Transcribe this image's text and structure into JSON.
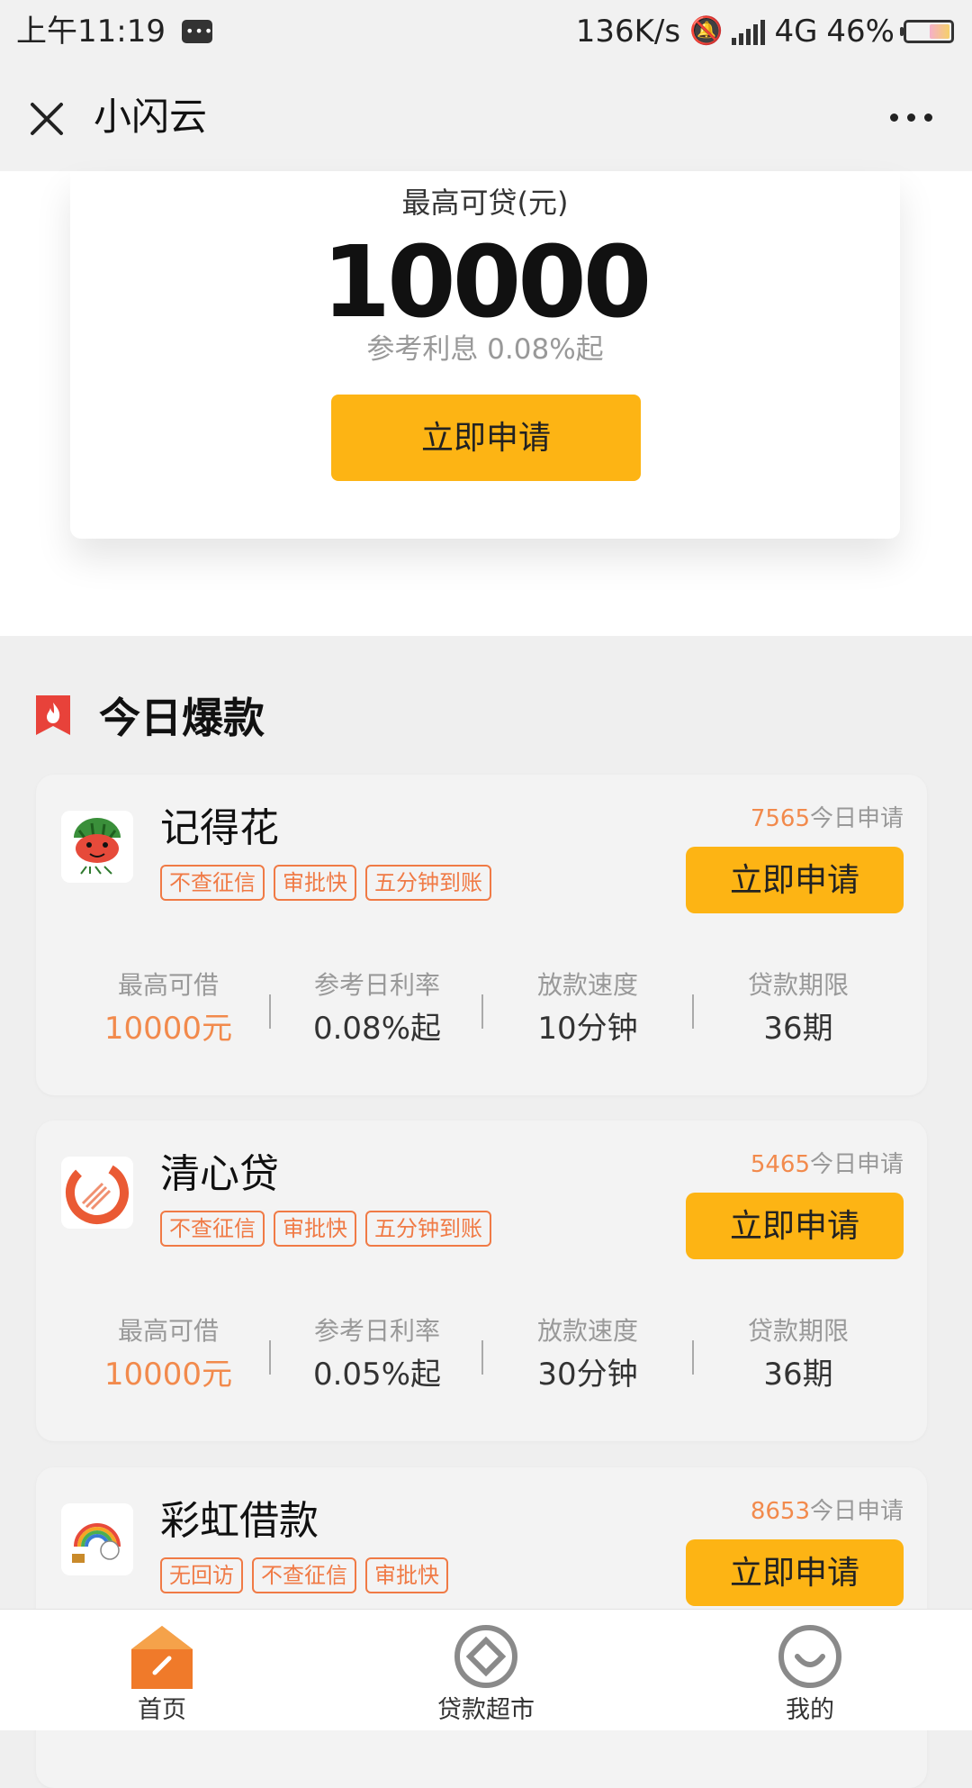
{
  "status_bar": {
    "time": "上午11:19",
    "speed": "136K/s",
    "network": "4G",
    "battery": "46%"
  },
  "nav": {
    "title": "小闪云"
  },
  "hero": {
    "label": "最高可贷(元)",
    "amount": "10000",
    "rate": "参考利息 0.08%起",
    "apply_label": "立即申请"
  },
  "section": {
    "title": "今日爆款"
  },
  "labels": {
    "applies_suffix": "今日申请",
    "apply": "立即申请",
    "max_borrow": "最高可借",
    "daily_rate": "参考日利率",
    "speed": "放款速度",
    "term": "贷款期限"
  },
  "products": [
    {
      "name": "记得花",
      "tags": [
        "不查征信",
        "审批快",
        "五分钟到账"
      ],
      "applies": "7565",
      "max": "10000元",
      "rate": "0.08%起",
      "speed": "10分钟",
      "term": "36期"
    },
    {
      "name": "清心贷",
      "tags": [
        "不查征信",
        "审批快",
        "五分钟到账"
      ],
      "applies": "5465",
      "max": "10000元",
      "rate": "0.05%起",
      "speed": "30分钟",
      "term": "36期"
    },
    {
      "name": "彩虹借款",
      "tags": [
        "无回访",
        "不查征信",
        "审批快"
      ],
      "applies": "8653"
    }
  ],
  "tabs": [
    {
      "label": "首页",
      "icon": "home-icon",
      "active": true
    },
    {
      "label": "贷款超市",
      "icon": "loan-market-icon",
      "active": false
    },
    {
      "label": "我的",
      "icon": "profile-icon",
      "active": false
    }
  ],
  "colors": {
    "accent_button": "#fdb414",
    "accent_text": "#f28a4c",
    "tag_border": "#f07a45"
  }
}
